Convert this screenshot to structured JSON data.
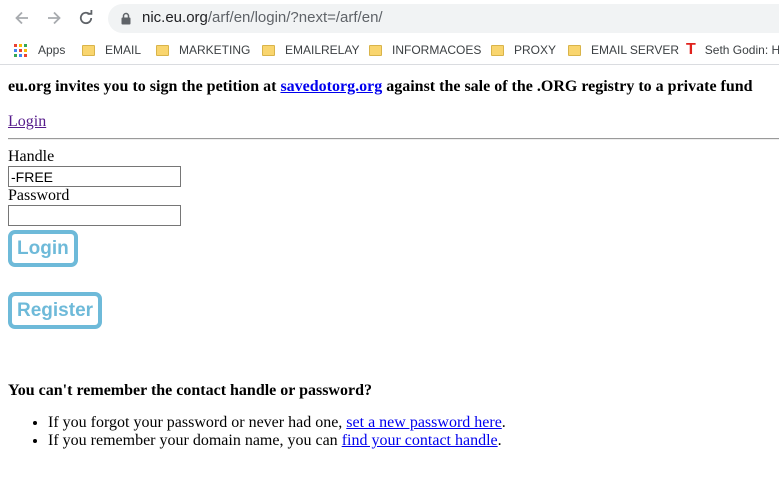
{
  "browser": {
    "url_host": "nic.eu.org",
    "url_path": "/arf/en/login/?next=/arf/en/",
    "bookmarks": [
      "Apps",
      "EMAIL",
      "MARKETING",
      "EMAILRELAY",
      "INFORMACOES",
      "PROXY",
      "EMAIL SERVER",
      "Seth Godin: H"
    ]
  },
  "page": {
    "petition_prefix": "eu.org invites you to sign the petition at ",
    "petition_link": "savedotorg.org",
    "petition_suffix": " against the sale of the .ORG registry to a private fund",
    "login_link": "Login",
    "handle_label": "Handle",
    "handle_value": "-FREE",
    "password_label": "Password",
    "password_value": "",
    "login_button": "Login",
    "register_button": "Register",
    "help_heading": "You can't remember the contact handle or password?",
    "help_items": [
      {
        "prefix": "If you forgot your password or never had one, ",
        "link": "set a new password here",
        "suffix": "."
      },
      {
        "prefix": "If you remember your domain name, you can ",
        "link": "find your contact handle",
        "suffix": "."
      }
    ]
  },
  "colors": {
    "button_accent": "#6ebad9",
    "link": "#0000ee",
    "visited_link": "#551a8b"
  }
}
